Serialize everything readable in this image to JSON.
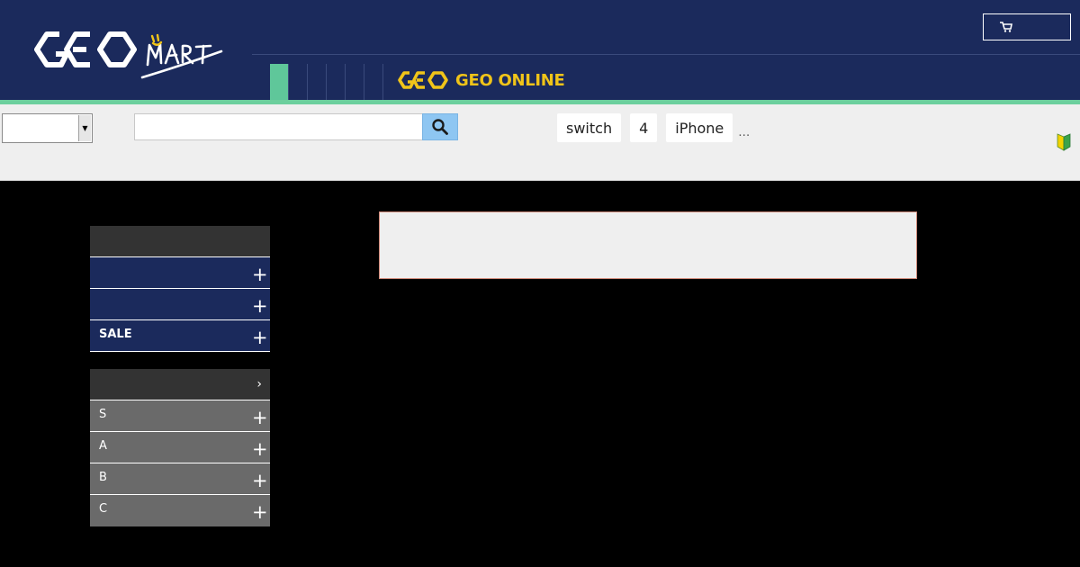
{
  "header": {
    "brand": "GEO MART",
    "cart_label": "",
    "nav_tabs": [
      "",
      "",
      "",
      "",
      "",
      ""
    ],
    "geo_online_label": "GEO ONLINE"
  },
  "search": {
    "category_value": "",
    "placeholder": "",
    "keywords": [
      "switch",
      "4",
      "iPhone"
    ],
    "more_label": "…"
  },
  "sidebar": {
    "block1": {
      "head": "",
      "items": [
        {
          "label": ""
        },
        {
          "label": ""
        },
        {
          "label": "SALE"
        }
      ]
    },
    "block2": {
      "head": "",
      "head_arrow": "›",
      "items": [
        {
          "label": "S"
        },
        {
          "label": "A"
        },
        {
          "label": "B"
        },
        {
          "label": "C"
        }
      ]
    }
  },
  "colors": {
    "header_bg": "#1b2a5c",
    "accent": "#6ccf9d",
    "search_button": "#8ec6f2",
    "geo_yellow": "#f0c419"
  },
  "icons": {
    "cart": "cart-icon",
    "search": "magnifier-icon",
    "beginner": "beginner-mark-icon",
    "expand": "plus-icon"
  }
}
